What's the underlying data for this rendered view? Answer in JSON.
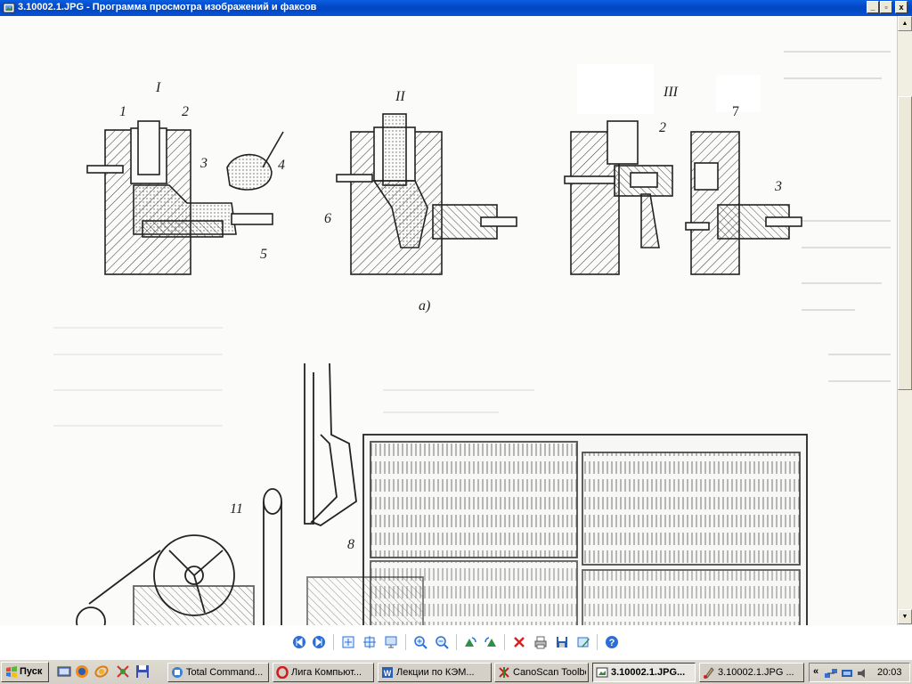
{
  "window": {
    "title": "3.10002.1.JPG - Программа просмотра изображений и факсов",
    "minimize_glyph": "_",
    "maximize_glyph": "▫",
    "close_glyph": "x"
  },
  "figure": {
    "group_labels": [
      "I",
      "II",
      "III"
    ],
    "part_numbers": [
      "1",
      "2",
      "3",
      "4",
      "5",
      "6",
      "2",
      "7",
      "3",
      "11",
      "8"
    ],
    "caption": "a)"
  },
  "viewer_toolbar": {
    "buttons": [
      {
        "name": "previous-image-icon"
      },
      {
        "name": "next-image-icon"
      },
      {
        "name": "best-fit-icon"
      },
      {
        "name": "actual-size-icon"
      },
      {
        "name": "slideshow-icon"
      },
      {
        "name": "zoom-in-icon"
      },
      {
        "name": "zoom-out-icon"
      },
      {
        "name": "rotate-clockwise-icon"
      },
      {
        "name": "rotate-counterclockwise-icon"
      },
      {
        "name": "delete-icon"
      },
      {
        "name": "print-icon"
      },
      {
        "name": "save-icon"
      },
      {
        "name": "edit-icon"
      },
      {
        "name": "help-icon"
      }
    ]
  },
  "taskbar": {
    "start_label": "Пуск",
    "tasks": [
      {
        "label": "Total Command...",
        "icon": "total-commander-icon",
        "active": false
      },
      {
        "label": "Лига Компьют...",
        "icon": "opera-icon",
        "active": false
      },
      {
        "label": "Лекции по КЭМ...",
        "icon": "word-document-icon",
        "active": false
      },
      {
        "label": "CanoScan Toolbox",
        "icon": "canoscan-icon",
        "active": false
      },
      {
        "label": "3.10002.1.JPG...",
        "icon": "image-viewer-icon",
        "active": true
      },
      {
        "label": "3.10002.1.JPG ...",
        "icon": "paint-icon",
        "active": false
      }
    ],
    "tray_expand": "«",
    "clock": "20:03"
  }
}
